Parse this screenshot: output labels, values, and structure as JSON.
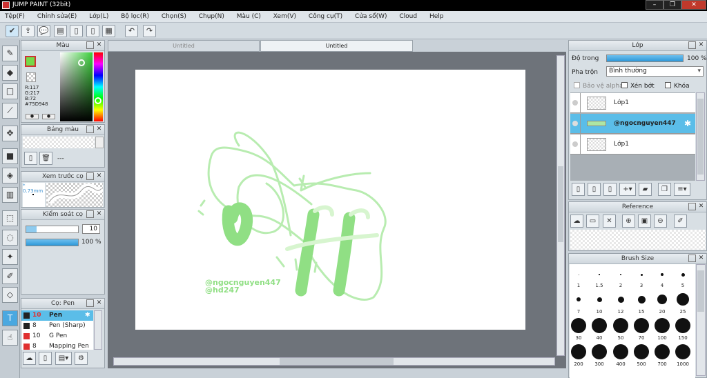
{
  "app": {
    "title": "JUMP PAINT (32bit)"
  },
  "menu": [
    "Tệp(F)",
    "Chỉnh sửa(E)",
    "Lớp(L)",
    "Bộ lọc(R)",
    "Chọn(S)",
    "Chụp(N)",
    "Màu (C)",
    "Xem(V)",
    "Công cụ(T)",
    "Cửa sổ(W)",
    "Cloud",
    "Help"
  ],
  "tabs": [
    "Untitled",
    "Untitled"
  ],
  "color_panel": {
    "title": "Màu",
    "r": "R:117",
    "g": "G:217",
    "b": "B:72",
    "hex": "#75D948",
    "current": "#75D948"
  },
  "swatch_panel": {
    "title": "Bảng màu",
    "value": "---"
  },
  "preview_panel": {
    "title": "Xem trước cọ",
    "size": "* 0.73mm"
  },
  "brush_control": {
    "title": "Kiểm soát cọ",
    "size": "10",
    "opacity": "100 %"
  },
  "pen_panel": {
    "title": "Cọ: Pen",
    "items": [
      {
        "size": "10",
        "name": "Pen",
        "color": "#222222"
      },
      {
        "size": "8",
        "name": "Pen (Sharp)",
        "color": "#222222"
      },
      {
        "size": "10",
        "name": "G Pen",
        "color": "#e03030"
      },
      {
        "size": "8",
        "name": "Mapping Pen",
        "color": "#e03030"
      }
    ]
  },
  "layer_panel": {
    "title": "Lớp",
    "opacity_label": "Độ trong",
    "opacity_value": "100 %",
    "blend_label": "Pha trộn",
    "blend_value": "Bình thường",
    "protect_alpha": "Bảo vệ alpha",
    "clip": "Xén bớt",
    "lock": "Khóa",
    "layers": [
      "Lớp1",
      "@ngocnguyen447",
      "Lớp1"
    ]
  },
  "reference_panel": {
    "title": "Reference"
  },
  "brush_size_panel": {
    "title": "Brush Size",
    "sizes": [
      "1",
      "1.5",
      "2",
      "3",
      "4",
      "5",
      "7",
      "10",
      "12",
      "15",
      "20",
      "25",
      "30",
      "40",
      "50",
      "70",
      "100",
      "150",
      "200",
      "300",
      "400",
      "500",
      "700",
      "1000"
    ]
  },
  "artwork": {
    "title_text": "Off",
    "credit1": "@ngocnguyen447",
    "credit2": "@hd247",
    "accent": "#75D948"
  }
}
